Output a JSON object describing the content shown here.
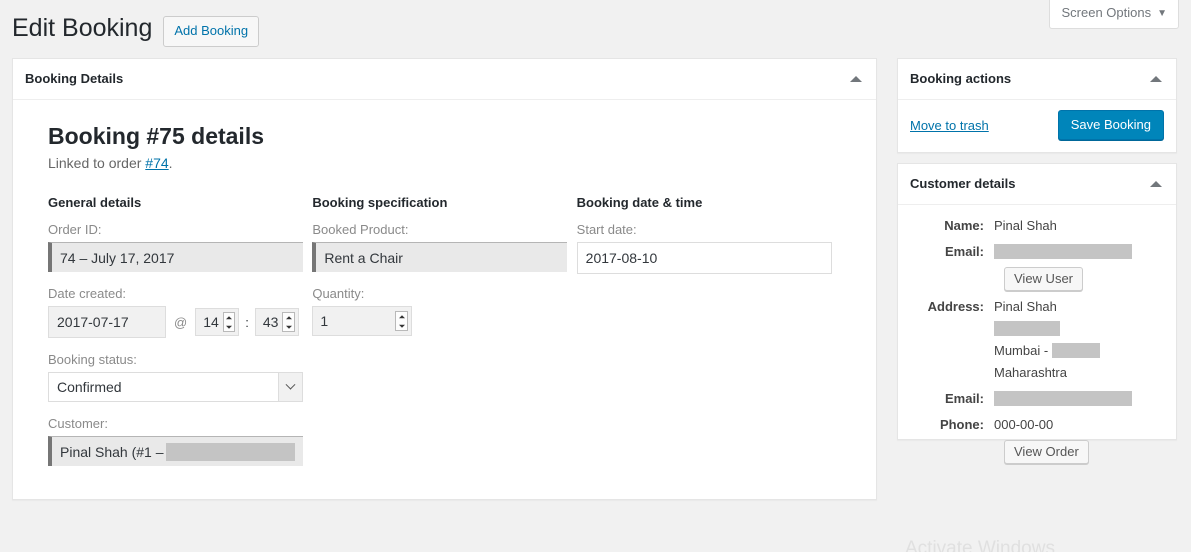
{
  "screen_options": {
    "label": "Screen Options",
    "caret": "chevron-down"
  },
  "header": {
    "title": "Edit Booking",
    "add_button": "Add Booking"
  },
  "main_panel": {
    "title": "Booking Details",
    "heading": "Booking #75 details",
    "linked_prefix": "Linked to order ",
    "linked_order": "#74",
    "linked_suffix": ".",
    "general": {
      "section_title": "General details",
      "order_id_label": "Order ID:",
      "order_id_value": "74 – July 17, 2017",
      "date_created_label": "Date created:",
      "date_created_value": "2017-07-17",
      "at_symbol": "@",
      "hour_value": "14",
      "separator": ":",
      "minute_value": "43",
      "status_label": "Booking status:",
      "status_value": "Confirmed",
      "customer_label": "Customer:",
      "customer_value": "Pinal Shah (#1 –"
    },
    "specification": {
      "section_title": "Booking specification",
      "product_label": "Booked Product:",
      "product_value": "Rent a Chair",
      "quantity_label": "Quantity:",
      "quantity_value": "1"
    },
    "datetime": {
      "section_title": "Booking date & time",
      "start_date_label": "Start date:",
      "start_date_value": "2017-08-10"
    }
  },
  "booking_actions": {
    "title": "Booking actions",
    "trash_link": "Move to trash",
    "save_button": "Save Booking"
  },
  "customer_details": {
    "title": "Customer details",
    "name_label": "Name:",
    "name_value": "Pinal Shah",
    "email_label": "Email:",
    "email_value": "",
    "view_user_button": "View User",
    "address_label": "Address:",
    "address_line1": "Pinal Shah",
    "address_line2": "",
    "address_city_prefix": "Mumbai - ",
    "address_zip": "",
    "address_state": "Maharashtra",
    "email2_label": "Email:",
    "email2_value": "",
    "phone_label": "Phone:",
    "phone_value": "000-00-00",
    "view_order_button": "View Order"
  },
  "watermark": {
    "text": "Activate Windows"
  },
  "colors": {
    "accent": "#0073aa",
    "primary_button": "#0085ba",
    "page_bg": "#f1f1f1",
    "panel_bg": "#ffffff",
    "redaction": "#c4c4c4"
  }
}
